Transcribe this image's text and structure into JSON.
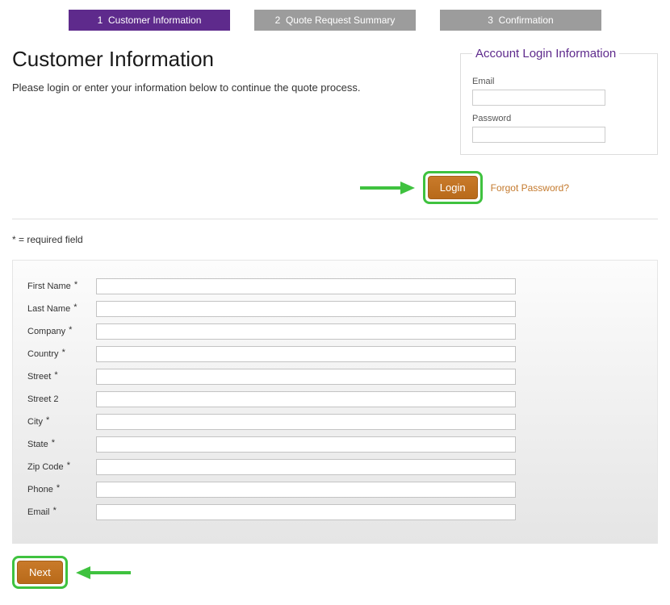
{
  "steps": [
    {
      "num": "1",
      "label": "Customer Information"
    },
    {
      "num": "2",
      "label": "Quote Request Summary"
    },
    {
      "num": "3",
      "label": "Confirmation"
    }
  ],
  "header": {
    "title": "Customer Information",
    "subtitle": "Please login or enter your information below to continue the quote process."
  },
  "login": {
    "legend": "Account Login Information",
    "email_label": "Email",
    "email_value": "",
    "password_label": "Password",
    "password_value": "",
    "login_button": "Login",
    "forgot_link": "Forgot Password?"
  },
  "required_note": "* = required field",
  "form": {
    "fields": [
      {
        "label": "First Name",
        "required": true,
        "value": ""
      },
      {
        "label": "Last Name",
        "required": true,
        "value": ""
      },
      {
        "label": "Company",
        "required": true,
        "value": ""
      },
      {
        "label": "Country",
        "required": true,
        "value": ""
      },
      {
        "label": "Street",
        "required": true,
        "value": ""
      },
      {
        "label": "Street 2",
        "required": false,
        "value": ""
      },
      {
        "label": "City",
        "required": true,
        "value": ""
      },
      {
        "label": "State",
        "required": true,
        "value": ""
      },
      {
        "label": "Zip Code",
        "required": true,
        "value": ""
      },
      {
        "label": "Phone",
        "required": true,
        "value": ""
      },
      {
        "label": "Email",
        "required": true,
        "value": ""
      }
    ]
  },
  "next_button": "Next",
  "colors": {
    "step_active": "#5e2a8c",
    "step_inactive": "#9c9c9c",
    "highlight_green": "#3fc23f",
    "button_orange": "#c97a2a",
    "link_orange": "#c47a2e"
  }
}
